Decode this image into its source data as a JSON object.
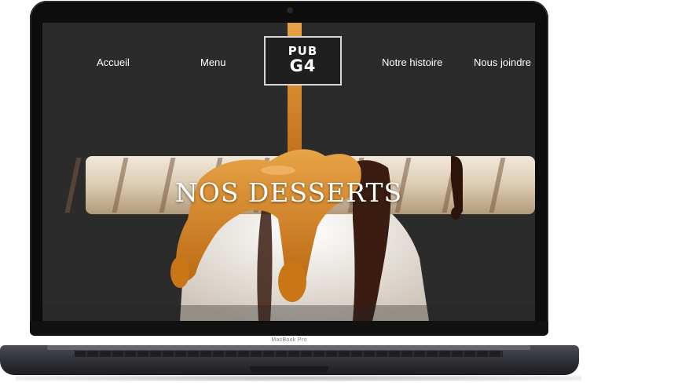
{
  "nav": {
    "links": [
      "Accueil",
      "Menu",
      "Notre histoire",
      "Nous joindre"
    ],
    "logo_line1": "PUB",
    "logo_line2": "G4"
  },
  "hero": {
    "title": "NOS DESSERTS"
  },
  "device": {
    "model_label": "MacBook Pro"
  },
  "colors": {
    "page_background": "#2b2b2c",
    "caramel": "#d9871f",
    "chocolate": "#3a1c10",
    "ice_cream": "#ece7df"
  }
}
